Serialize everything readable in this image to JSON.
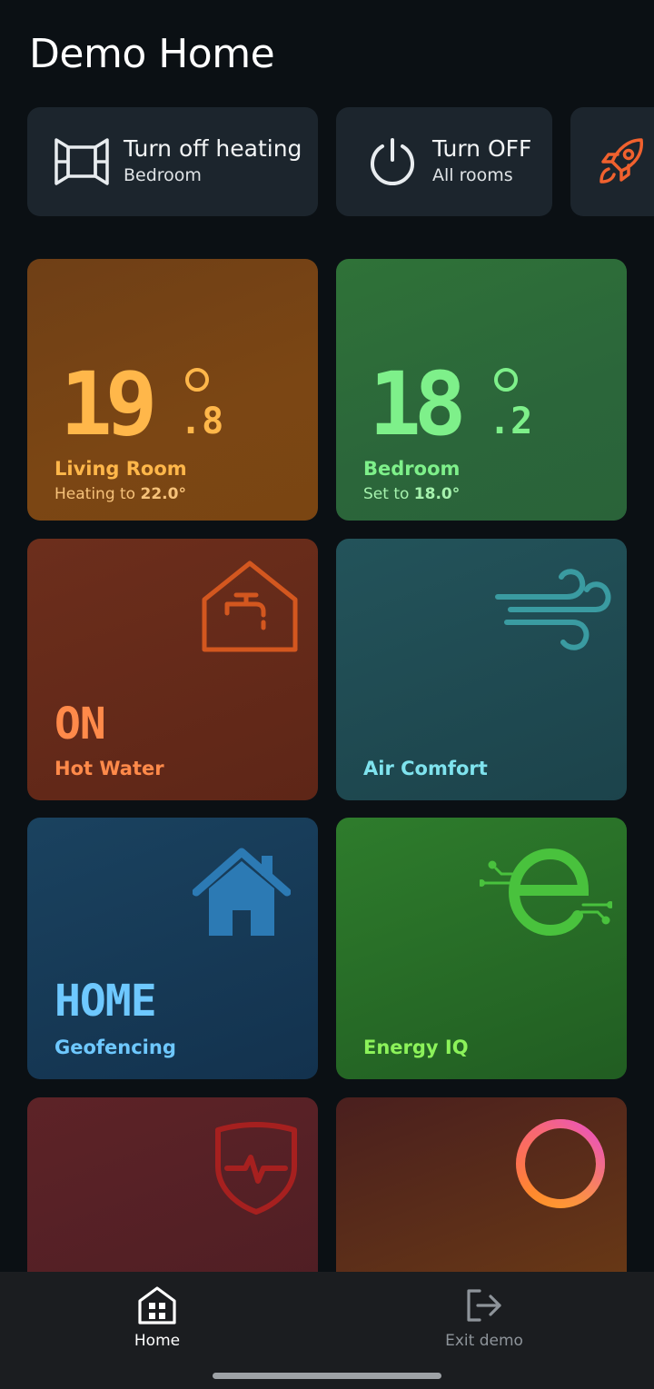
{
  "header": {
    "title": "Demo Home"
  },
  "quick_actions": [
    {
      "main": "Turn off heating",
      "sub": "Bedroom",
      "icon": "window-icon"
    },
    {
      "main": "Turn OFF",
      "sub": "All rooms",
      "icon": "power-icon"
    },
    {
      "icon": "rocket-icon"
    }
  ],
  "tiles": {
    "living_room": {
      "temp_int": "19",
      "temp_dec": "8",
      "name": "Living Room",
      "desc_prefix": "Heating to ",
      "desc_value": "22.0°",
      "color": "#ffb74a"
    },
    "bedroom": {
      "temp_int": "18",
      "temp_dec": "2",
      "name": "Bedroom",
      "desc_prefix": "Set to ",
      "desc_value": "18.0°",
      "color": "#7ef08a"
    },
    "hot_water": {
      "state": "ON",
      "name": "Hot Water",
      "color": "#ff8a4a"
    },
    "air_comfort": {
      "name": "Air Comfort",
      "color": "#7fe3ee"
    },
    "geofencing": {
      "state": "HOME",
      "name": "Geofencing",
      "color": "#6ec8ff"
    },
    "energy_iq": {
      "name": "Energy IQ",
      "color": "#8cf25a"
    }
  },
  "nav": [
    {
      "label": "Home",
      "icon": "home-grid-icon",
      "active": true
    },
    {
      "label": "Exit demo",
      "icon": "exit-icon",
      "active": false
    }
  ]
}
